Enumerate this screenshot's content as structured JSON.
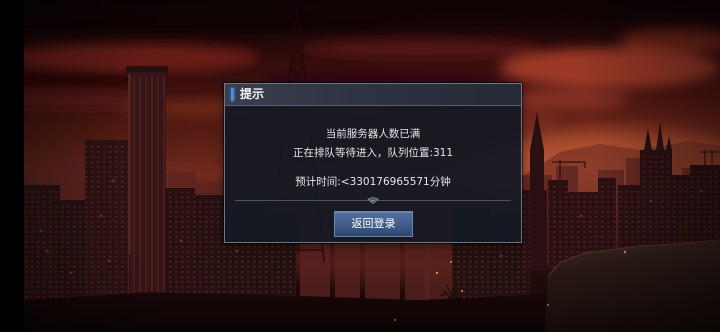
{
  "dialog": {
    "title": "提示",
    "message_line1": "当前服务器人数已满",
    "message_line2": "正在排队等待进入，队列位置:311",
    "eta": "预计时间:<330176965571分钟",
    "button_label": "返回登录"
  },
  "icons": {
    "divider_ornament": "diamond-icon"
  },
  "colors": {
    "title_accent": "#3f8fe0",
    "dialog_background": "#141823",
    "dialog_border": "#6d7689",
    "button": "#3f5d88",
    "text": "#e6e6e6"
  }
}
